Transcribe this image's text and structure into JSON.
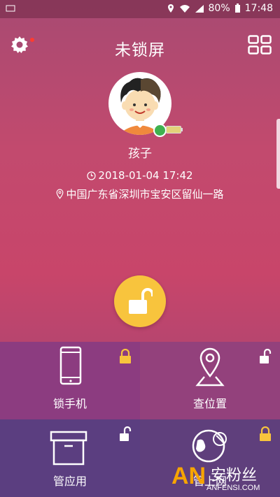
{
  "status_bar": {
    "battery_percent": "80%",
    "time": "17:48",
    "icons": [
      "location-icon",
      "wifi-icon",
      "signal-icon",
      "battery-icon"
    ]
  },
  "header": {
    "title": "未锁屏",
    "left_icon": "gear-icon",
    "right_icon": "grid-icon",
    "notification_dot_color": "#ff3b30"
  },
  "profile": {
    "name": "孩子",
    "timestamp": "2018-01-04 17:42",
    "location": "中国广东省深圳市宝安区留仙一路",
    "platform_icon": "android-icon",
    "battery_level": 0.6
  },
  "lock_button": {
    "state": "unlocked",
    "color": "#f8c43d"
  },
  "tiles": [
    {
      "label": "锁手机",
      "icon": "phone-icon",
      "badge": "lock-icon",
      "badge_color": "#f8c43d"
    },
    {
      "label": "查位置",
      "icon": "map-pin-icon",
      "badge": "unlock-icon",
      "badge_color": "#ffffff"
    },
    {
      "label": "管应用",
      "icon": "box-icon",
      "badge": "unlock-icon",
      "badge_color": "#ffffff"
    },
    {
      "label": "管上网",
      "icon": "globe-icon",
      "badge": "lock-icon",
      "badge_color": "#f8c43d"
    }
  ],
  "watermark": {
    "brand": "AN",
    "text": "安粉丝",
    "url": "ANFENSI.COM"
  }
}
